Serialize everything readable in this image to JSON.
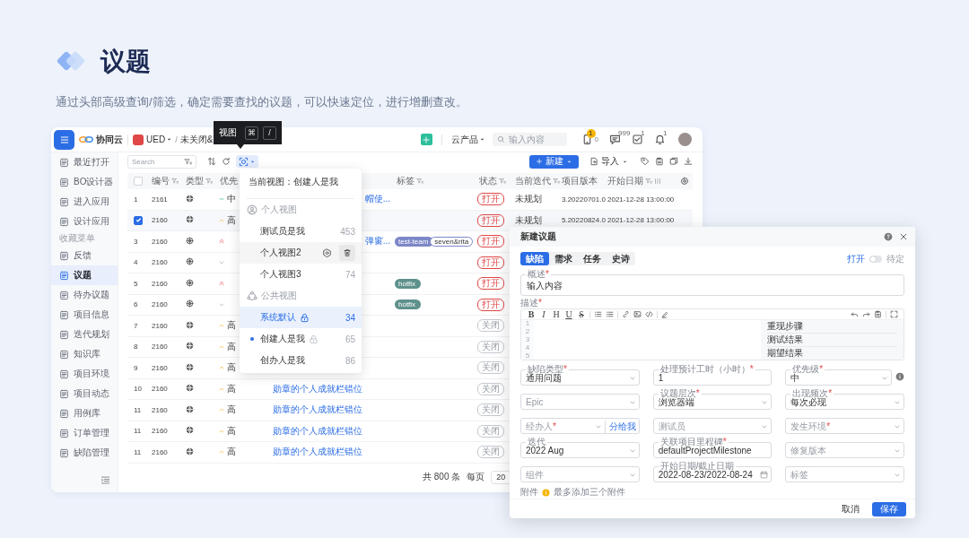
{
  "page": {
    "title": "议题",
    "subtitle": "通过头部高级查询/筛选，确定需要查找的议题，可以快速定位，进行增删查改。"
  },
  "topbar": {
    "app_name": "协同云",
    "project": "UED",
    "separator": "/",
    "breadcrumb": "未关闭&",
    "product_menu": "云产品",
    "search": {
      "placeholder": "输入内容"
    },
    "notifications": [
      {
        "kind": "phone",
        "badge": "1",
        "count": "0"
      },
      {
        "kind": "message",
        "badge": "999"
      },
      {
        "kind": "task",
        "badge": "1"
      },
      {
        "kind": "bell",
        "badge": "1"
      }
    ]
  },
  "tooltip": {
    "label": "视图",
    "keys": [
      "⌘",
      "/"
    ]
  },
  "sidebar": {
    "items": [
      {
        "label": "最近打开",
        "selected": false
      },
      {
        "label": "BO设计器",
        "selected": false
      },
      {
        "label": "进入应用",
        "selected": false
      },
      {
        "label": "设计应用",
        "selected": false
      }
    ],
    "favorites_title": "收藏菜单",
    "favorites": [
      {
        "label": "反馈",
        "selected": false
      },
      {
        "label": "议题",
        "selected": true
      },
      {
        "label": "待办议题",
        "selected": false
      },
      {
        "label": "项目信息",
        "selected": false
      },
      {
        "label": "迭代规划",
        "selected": false
      },
      {
        "label": "知识库",
        "selected": false
      },
      {
        "label": "项目环境",
        "selected": false
      },
      {
        "label": "项目动态",
        "selected": false
      },
      {
        "label": "用例库",
        "selected": false
      },
      {
        "label": "订单管理",
        "selected": false
      },
      {
        "label": "缺陷管理",
        "selected": false
      }
    ]
  },
  "toolbar": {
    "search": {
      "placeholder": "Search"
    },
    "view_button": {
      "selected": true
    },
    "new_button": "新建",
    "import_button": "导入"
  },
  "table": {
    "select_all": {
      "checked": false
    },
    "columns": [
      {
        "label": "编号",
        "filter": true
      },
      {
        "label": "类型",
        "filter": true
      },
      {
        "label": "优先",
        "filter": false
      },
      {
        "label": "标签",
        "filter": true
      },
      {
        "label": "状态",
        "filter": true
      },
      {
        "label": "当前迭代",
        "filter": true
      },
      {
        "label": "项目版本",
        "filter": false
      },
      {
        "label": "开始日期",
        "filter": true
      }
    ],
    "rows": [
      {
        "index": "1",
        "id": "2161",
        "type": {
          "kind": "filled"
        },
        "priority": {
          "kind": "medium",
          "text": "中"
        },
        "title": "帽使...",
        "title_cut": true,
        "status": {
          "kind": "open",
          "text": "打开"
        },
        "iteration": "未规划",
        "version": "3.20220701.0",
        "start": "2021-12-28 13:00:00",
        "checked": false
      },
      {
        "id": "2160",
        "type": {
          "kind": "filled"
        },
        "priority": {
          "kind": "high",
          "text": "高"
        },
        "status": {
          "kind": "open",
          "text": "打开"
        },
        "iteration": "未规划",
        "version": "5.20220824.0",
        "start": "2021-12-28 13:00:00",
        "checked": true
      },
      {
        "index": "3",
        "id": "2160",
        "type": {
          "kind": "outline"
        },
        "priority": {
          "kind": "highest"
        },
        "title": "弹窗...",
        "title_cut": true,
        "tags": [
          {
            "label": "test-team",
            "color": "#7d87c8",
            "kind": "filled"
          },
          {
            "label": "seven&rita",
            "color": "#7d87c8",
            "kind": "outline"
          }
        ],
        "status": {
          "kind": "open",
          "text": "打开"
        },
        "checked": false
      },
      {
        "index": "4",
        "id": "2160",
        "type": {
          "kind": "outline"
        },
        "priority": {
          "kind": "low"
        },
        "status": {
          "kind": "open",
          "text": "打开"
        },
        "checked": false
      },
      {
        "index": "5",
        "id": "2160",
        "type": {
          "kind": "outline"
        },
        "priority": {
          "kind": "highest"
        },
        "tags": [
          {
            "label": "hotfix",
            "color": "#5e918b",
            "kind": "filled"
          }
        ],
        "status": {
          "kind": "open",
          "text": "打开"
        },
        "checked": false
      },
      {
        "index": "6",
        "id": "2160",
        "type": {
          "kind": "outline"
        },
        "priority": {
          "kind": "low"
        },
        "tags": [
          {
            "label": "hotfix",
            "color": "#5e918b",
            "kind": "filled"
          }
        ],
        "status": {
          "kind": "open",
          "text": "打开"
        },
        "checked": false
      },
      {
        "index": "7",
        "id": "2160",
        "type": {
          "kind": "filled"
        },
        "priority": {
          "kind": "high",
          "text": "高"
        },
        "status": {
          "kind": "closed",
          "text": "关闭"
        },
        "checked": false
      },
      {
        "index": "8",
        "id": "2160",
        "type": {
          "kind": "filled"
        },
        "priority": {
          "kind": "high",
          "text": "高"
        },
        "status": {
          "kind": "closed",
          "text": "关闭"
        },
        "checked": false
      },
      {
        "index": "9",
        "id": "2160",
        "type": {
          "kind": "filled"
        },
        "priority": {
          "kind": "high",
          "text": "高"
        },
        "status": {
          "kind": "closed",
          "text": "关闭"
        },
        "checked": false
      },
      {
        "index": "10",
        "id": "2160",
        "type": {
          "kind": "filled"
        },
        "priority": {
          "kind": "high",
          "text": "高"
        },
        "title": "勋章的个人成就栏错位",
        "status": {
          "kind": "closed",
          "text": "关闭"
        },
        "checked": false
      },
      {
        "index": "11",
        "id": "2160",
        "type": {
          "kind": "filled"
        },
        "priority": {
          "kind": "high",
          "text": "高"
        },
        "title": "勋章的个人成就栏错位",
        "status": {
          "kind": "closed",
          "text": "关闭"
        },
        "checked": false
      },
      {
        "index": "11",
        "id": "2160",
        "type": {
          "kind": "filled"
        },
        "priority": {
          "kind": "high",
          "text": "高"
        },
        "title": "勋章的个人成就栏错位",
        "status": {
          "kind": "closed",
          "text": "关闭"
        },
        "checked": false
      },
      {
        "index": "11",
        "id": "2160",
        "type": {
          "kind": "filled"
        },
        "priority": {
          "kind": "high",
          "text": "高"
        },
        "title": "勋章的个人成就栏错位",
        "status": {
          "kind": "closed",
          "text": "关闭"
        },
        "checked": false
      }
    ]
  },
  "pagination": {
    "total": "共 800 条",
    "per_page_label": "每页",
    "per_page": "20"
  },
  "view_menu": {
    "current": "当前视图：创建人是我",
    "groups": [
      {
        "title": "个人视图",
        "kind": "personal",
        "items": [
          {
            "label": "测试员是我",
            "count": "453",
            "selected": false,
            "current": false,
            "locked": false,
            "hovered": false
          },
          {
            "label": "个人视图2",
            "selected": false,
            "current": false,
            "locked": false,
            "hovered": true
          },
          {
            "label": "个人视图3",
            "count": "74",
            "selected": false,
            "current": false,
            "locked": false,
            "hovered": false
          }
        ]
      },
      {
        "title": "公共视图",
        "kind": "public",
        "items": [
          {
            "label": "系统默认",
            "count": "34",
            "selected": true,
            "current": false,
            "locked": true,
            "hovered": false
          },
          {
            "label": "创建人是我",
            "count": "65",
            "selected": false,
            "current": true,
            "locked": true,
            "hovered": false
          },
          {
            "label": "创办人是我",
            "count": "86",
            "selected": false,
            "current": false,
            "locked": false,
            "hovered": false
          }
        ]
      }
    ]
  },
  "dialog": {
    "title": "新建议题",
    "tabs": [
      {
        "label": "缺陷",
        "selected": true
      },
      {
        "label": "需求",
        "selected": false
      },
      {
        "label": "任务",
        "selected": false
      },
      {
        "label": "史诗",
        "selected": false
      }
    ],
    "toggle": {
      "left_label": "打开",
      "right_label": "待定",
      "on": false
    },
    "summary": {
      "label": "概述",
      "required_mark": "*",
      "value": "输入内容"
    },
    "description": {
      "label": "描述",
      "required_mark": "*",
      "format_buttons": [
        "B",
        "I",
        "H",
        "U",
        "S"
      ],
      "line_numbers": [
        "1",
        "2",
        "3",
        "4",
        "5"
      ],
      "templates": [
        "重现步骤",
        "测试结果",
        "期望结果"
      ]
    },
    "fields": [
      {
        "label": "缺陷类型",
        "required_mark": "*",
        "value": "通用问题",
        "kind": "select"
      },
      {
        "label": "处理预计工时（小时）",
        "required_mark": "*",
        "value": "1",
        "kind": "input"
      },
      {
        "label": "优先级",
        "required_mark": "*",
        "value": "中",
        "kind": "select",
        "help": true
      },
      {
        "placeholder": "Epic",
        "kind": "select"
      },
      {
        "label": "议题层次",
        "required_mark": "*",
        "value": "浏览器端",
        "kind": "select"
      },
      {
        "label": "出现频次",
        "required_mark": "*",
        "value": "每次必现",
        "kind": "select"
      },
      {
        "placeholder": "经办人",
        "required_mark": "*",
        "kind": "select",
        "action": "分给我"
      },
      {
        "placeholder": "测试员",
        "kind": "select"
      },
      {
        "placeholder": "发生环境",
        "required_mark": "*",
        "kind": "select"
      },
      {
        "label": "迭代",
        "value": "2022 Aug",
        "kind": "select"
      },
      {
        "label": "关联项目里程碑",
        "required_mark": "*",
        "value": "defaultProjectMilestone",
        "kind": "input"
      },
      {
        "placeholder": "修复版本",
        "kind": "select"
      },
      {
        "placeholder": "组件",
        "kind": "select"
      },
      {
        "label": "开始日期/截止日期",
        "value": "2022-08-23/2022-08-24",
        "kind": "date"
      },
      {
        "placeholder": "标签",
        "kind": "select"
      }
    ],
    "attachment": {
      "label": "附件",
      "hint": "最多添加三个附件"
    },
    "cancel_button": "取消",
    "save_button": "保存"
  }
}
